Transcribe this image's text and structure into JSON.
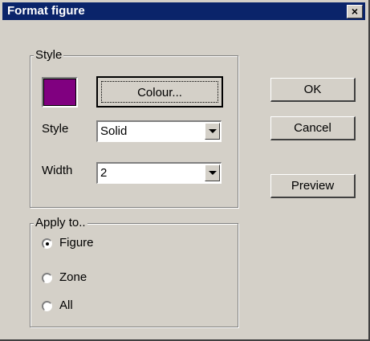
{
  "window": {
    "title": "Format figure",
    "close_glyph": "×"
  },
  "style_group": {
    "label": "Style",
    "swatch_color": "#800080",
    "colour_button": "Colour...",
    "style_label": "Style",
    "style_value": "Solid",
    "width_label": "Width",
    "width_value": "2"
  },
  "apply_group": {
    "label": "Apply to..",
    "options": [
      {
        "label": "Figure",
        "checked": true
      },
      {
        "label": "Zone",
        "checked": false
      },
      {
        "label": "All",
        "checked": false
      }
    ]
  },
  "buttons": {
    "ok": "OK",
    "cancel": "Cancel",
    "preview": "Preview"
  }
}
